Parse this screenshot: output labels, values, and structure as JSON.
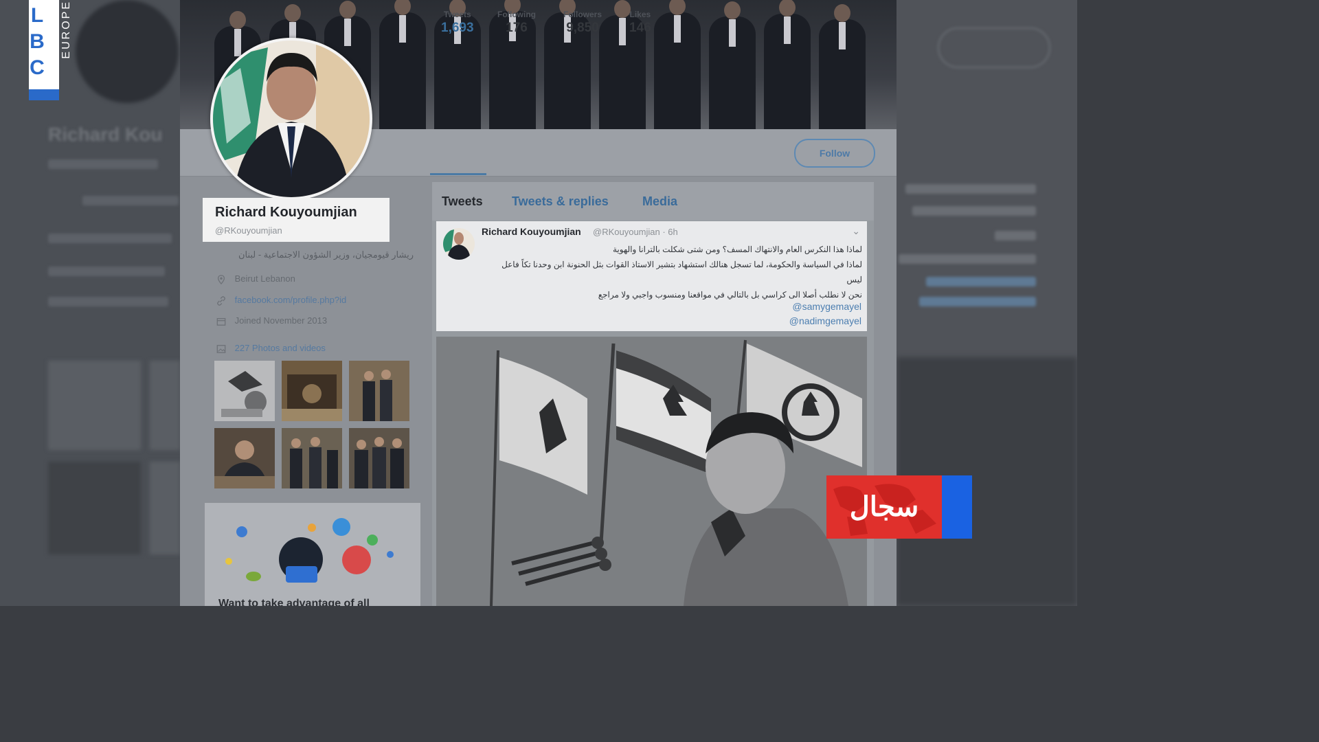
{
  "broadcast": {
    "channel_logo": "LBC",
    "channel_sub": "EUROPE",
    "program_badge": "سجال",
    "brand_colors": {
      "red": "#e0302c",
      "blue": "#1a62e2"
    }
  },
  "profile": {
    "name": "Richard Kouyoumjian",
    "handle": "@RKouyoumjian",
    "bio": "ريشار قيومجيان، وزير الشؤون الاجتماعية - لبنان",
    "location": "Beirut Lebanon",
    "website": "facebook.com/profile.php?id",
    "joined": "Joined November 2013",
    "photos_label": "227 Photos and videos"
  },
  "stats": [
    {
      "label": "Tweets",
      "value": "1,693",
      "active": true
    },
    {
      "label": "Following",
      "value": "176",
      "active": false
    },
    {
      "label": "Followers",
      "value": "9,850",
      "active": false
    },
    {
      "label": "Likes",
      "value": "146",
      "active": false
    }
  ],
  "follow_button": "Follow",
  "tabs": [
    {
      "label": "Tweets",
      "current": true
    },
    {
      "label": "Tweets & replies",
      "current": false
    },
    {
      "label": "Media",
      "current": false
    }
  ],
  "tweet": {
    "author": "Richard Kouyoumjian",
    "handle": "@RKouyoumjian · 6h",
    "lines": [
      "لماذا هذا النكرس العام والانتهاك المسف؟ ومن شتى شكلت بالترانا والهوية",
      "لماذا في السياسة والحكومة، لما تسجل هنالك استشهاد بتشير الاستاذ القوات بثل الحنونة ابن وحدنا تكاً فاعل",
      "ليس",
      "نحن لا نطلب أصلا الى كراسي بل بالتالي في مواقعنا ومنسوب واجبي ولا مراجع"
    ],
    "mentions": [
      "@samygemayel",
      "@nadimgemayel"
    ]
  },
  "promo": {
    "title": "Want to take advantage of all"
  },
  "icons": {
    "location": "map-pin-icon",
    "website": "link-icon",
    "joined": "calendar-icon",
    "photos": "image-icon",
    "chevron": "chevron-down-icon"
  }
}
